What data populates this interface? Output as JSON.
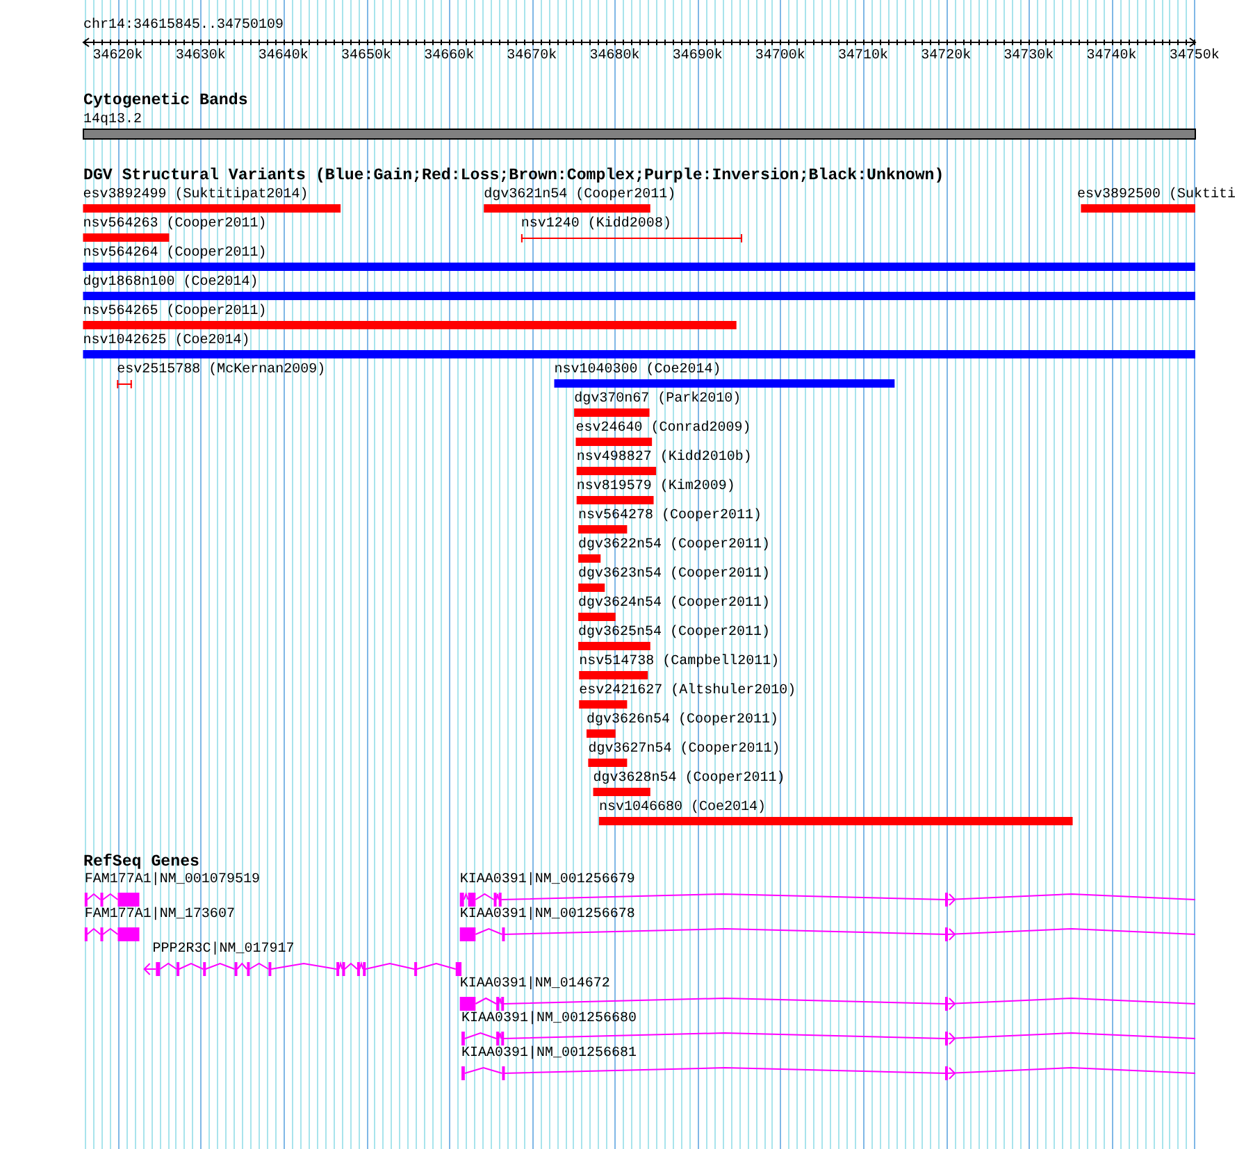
{
  "ruler": {
    "location": "chr14:34615845..34750109",
    "ticks": [
      "34620k",
      "34630k",
      "34640k",
      "34650k",
      "34660k",
      "34670k",
      "34680k",
      "34690k",
      "34700k",
      "34710k",
      "34720k",
      "34730k",
      "34740k",
      "34750k"
    ]
  },
  "cytoband_track": {
    "title": "Cytogenetic Bands",
    "band": {
      "name": "14q13.2"
    }
  },
  "variant_track": {
    "title": "DGV Structural Variants (Blue:Gain;Red:Loss;Brown:Complex;Purple:Inversion;Black:Unknown)",
    "rows": [
      {
        "features": [
          {
            "label": "esv3892499 (Suktitipat2014)",
            "color": "#ff0000",
            "kind": "bar"
          },
          {
            "label": "dgv3621n54 (Cooper2011)",
            "color": "#ff0000",
            "kind": "bar"
          },
          {
            "label": "esv3892500 (Suktiti",
            "color": "#ff0000",
            "kind": "bar"
          }
        ]
      },
      {
        "features": [
          {
            "label": "nsv564263 (Cooper2011)",
            "color": "#ff0000",
            "kind": "bar"
          },
          {
            "label": "nsv1240 (Kidd2008)",
            "color": "#ff0000",
            "kind": "span"
          }
        ]
      },
      {
        "features": [
          {
            "label": "nsv564264 (Cooper2011)",
            "color": "#0000ff",
            "kind": "bar"
          }
        ]
      },
      {
        "features": [
          {
            "label": "dgv1868n100 (Coe2014)",
            "color": "#0000ff",
            "kind": "bar"
          }
        ]
      },
      {
        "features": [
          {
            "label": "nsv564265 (Cooper2011)",
            "color": "#ff0000",
            "kind": "bar"
          }
        ]
      },
      {
        "features": [
          {
            "label": "nsv1042625 (Coe2014)",
            "color": "#0000ff",
            "kind": "bar"
          }
        ]
      },
      {
        "features": [
          {
            "label": "esv2515788 (McKernan2009)",
            "color": "#ff0000",
            "kind": "span"
          },
          {
            "label": "nsv1040300 (Coe2014)",
            "color": "#0000ff",
            "kind": "bar"
          }
        ]
      },
      {
        "features": [
          {
            "label": "dgv370n67 (Park2010)",
            "color": "#ff0000",
            "kind": "bar"
          }
        ]
      },
      {
        "features": [
          {
            "label": "esv24640 (Conrad2009)",
            "color": "#ff0000",
            "kind": "bar"
          }
        ]
      },
      {
        "features": [
          {
            "label": "nsv498827 (Kidd2010b)",
            "color": "#ff0000",
            "kind": "bar"
          }
        ]
      },
      {
        "features": [
          {
            "label": "nsv819579 (Kim2009)",
            "color": "#ff0000",
            "kind": "bar"
          }
        ]
      },
      {
        "features": [
          {
            "label": "nsv564278 (Cooper2011)",
            "color": "#ff0000",
            "kind": "bar"
          }
        ]
      },
      {
        "features": [
          {
            "label": "dgv3622n54 (Cooper2011)",
            "color": "#ff0000",
            "kind": "bar"
          }
        ]
      },
      {
        "features": [
          {
            "label": "dgv3623n54 (Cooper2011)",
            "color": "#ff0000",
            "kind": "bar"
          }
        ]
      },
      {
        "features": [
          {
            "label": "dgv3624n54 (Cooper2011)",
            "color": "#ff0000",
            "kind": "bar"
          }
        ]
      },
      {
        "features": [
          {
            "label": "dgv3625n54 (Cooper2011)",
            "color": "#ff0000",
            "kind": "bar"
          }
        ]
      },
      {
        "features": [
          {
            "label": "nsv514738 (Campbell2011)",
            "color": "#ff0000",
            "kind": "bar"
          }
        ]
      },
      {
        "features": [
          {
            "label": "esv2421627 (Altshuler2010)",
            "color": "#ff0000",
            "kind": "bar"
          }
        ]
      },
      {
        "features": [
          {
            "label": "dgv3626n54 (Cooper2011)",
            "color": "#ff0000",
            "kind": "bar"
          }
        ]
      },
      {
        "features": [
          {
            "label": "dgv3627n54 (Cooper2011)",
            "color": "#ff0000",
            "kind": "bar"
          }
        ]
      },
      {
        "features": [
          {
            "label": "dgv3628n54 (Cooper2011)",
            "color": "#ff0000",
            "kind": "bar"
          }
        ]
      },
      {
        "features": [
          {
            "label": "nsv1046680 (Coe2014)",
            "color": "#ff0000",
            "kind": "bar"
          }
        ]
      }
    ]
  },
  "gene_track": {
    "title": "RefSeq Genes",
    "rows": [
      {
        "genes": [
          {
            "label": "FAM177A1|NM_001079519"
          },
          {
            "label": "KIAA0391|NM_001256679"
          }
        ]
      },
      {
        "genes": [
          {
            "label": "FAM177A1|NM_173607"
          },
          {
            "label": "KIAA0391|NM_001256678"
          }
        ]
      },
      {
        "genes": [
          {
            "label": "PPP2R3C|NM_017917"
          }
        ]
      },
      {
        "genes": [
          {
            "label": "KIAA0391|NM_014672"
          }
        ]
      },
      {
        "genes": [
          {
            "label": "KIAA0391|NM_001256680"
          }
        ]
      },
      {
        "genes": [
          {
            "label": "KIAA0391|NM_001256681"
          }
        ]
      }
    ]
  }
}
